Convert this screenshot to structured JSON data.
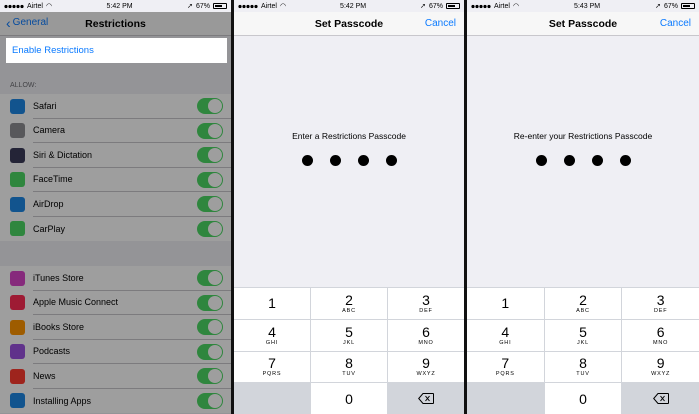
{
  "status": {
    "screen1": {
      "carrier": "Airtel",
      "time": "5:42 PM",
      "battery": "67%"
    },
    "screen2": {
      "carrier": "Airtel",
      "time": "5:42 PM",
      "battery": "67%"
    },
    "screen3": {
      "carrier": "Airtel",
      "time": "5:43 PM",
      "battery": "67%"
    }
  },
  "restrictions": {
    "back_label": "General",
    "title": "Restrictions",
    "enable_label": "Enable Restrictions",
    "allow_header": "ALLOW:",
    "group1": [
      {
        "label": "Safari",
        "icon": "safari-icon",
        "color": "#1e88e5"
      },
      {
        "label": "Camera",
        "icon": "camera-icon",
        "color": "#8e8e93"
      },
      {
        "label": "Siri & Dictation",
        "icon": "siri-icon",
        "color": "#3a3a5a"
      },
      {
        "label": "FaceTime",
        "icon": "facetime-icon",
        "color": "#4cd964"
      },
      {
        "label": "AirDrop",
        "icon": "airdrop-icon",
        "color": "#1e88e5"
      },
      {
        "label": "CarPlay",
        "icon": "carplay-icon",
        "color": "#4cd964"
      }
    ],
    "group2": [
      {
        "label": "iTunes Store",
        "icon": "itunes-store-icon",
        "color": "#d845c8"
      },
      {
        "label": "Apple Music Connect",
        "icon": "music-icon",
        "color": "#ff2d55"
      },
      {
        "label": "iBooks Store",
        "icon": "ibooks-icon",
        "color": "#ff9500"
      },
      {
        "label": "Podcasts",
        "icon": "podcasts-icon",
        "color": "#9b51e0"
      },
      {
        "label": "News",
        "icon": "news-icon",
        "color": "#ff3b30"
      },
      {
        "label": "Installing Apps",
        "icon": "app-store-icon",
        "color": "#1e88e5"
      }
    ]
  },
  "passcode1": {
    "title": "Set Passcode",
    "cancel_label": "Cancel",
    "prompt": "Enter a Restrictions Passcode"
  },
  "passcode2": {
    "title": "Set Passcode",
    "cancel_label": "Cancel",
    "prompt": "Re-enter your Restrictions Passcode"
  },
  "keypad": [
    {
      "num": "1",
      "letters": ""
    },
    {
      "num": "2",
      "letters": "ABC"
    },
    {
      "num": "3",
      "letters": "DEF"
    },
    {
      "num": "4",
      "letters": "GHI"
    },
    {
      "num": "5",
      "letters": "JKL"
    },
    {
      "num": "6",
      "letters": "MNO"
    },
    {
      "num": "7",
      "letters": "PQRS"
    },
    {
      "num": "8",
      "letters": "TUV"
    },
    {
      "num": "9",
      "letters": "WXYZ"
    },
    {
      "num": "0",
      "letters": ""
    }
  ]
}
